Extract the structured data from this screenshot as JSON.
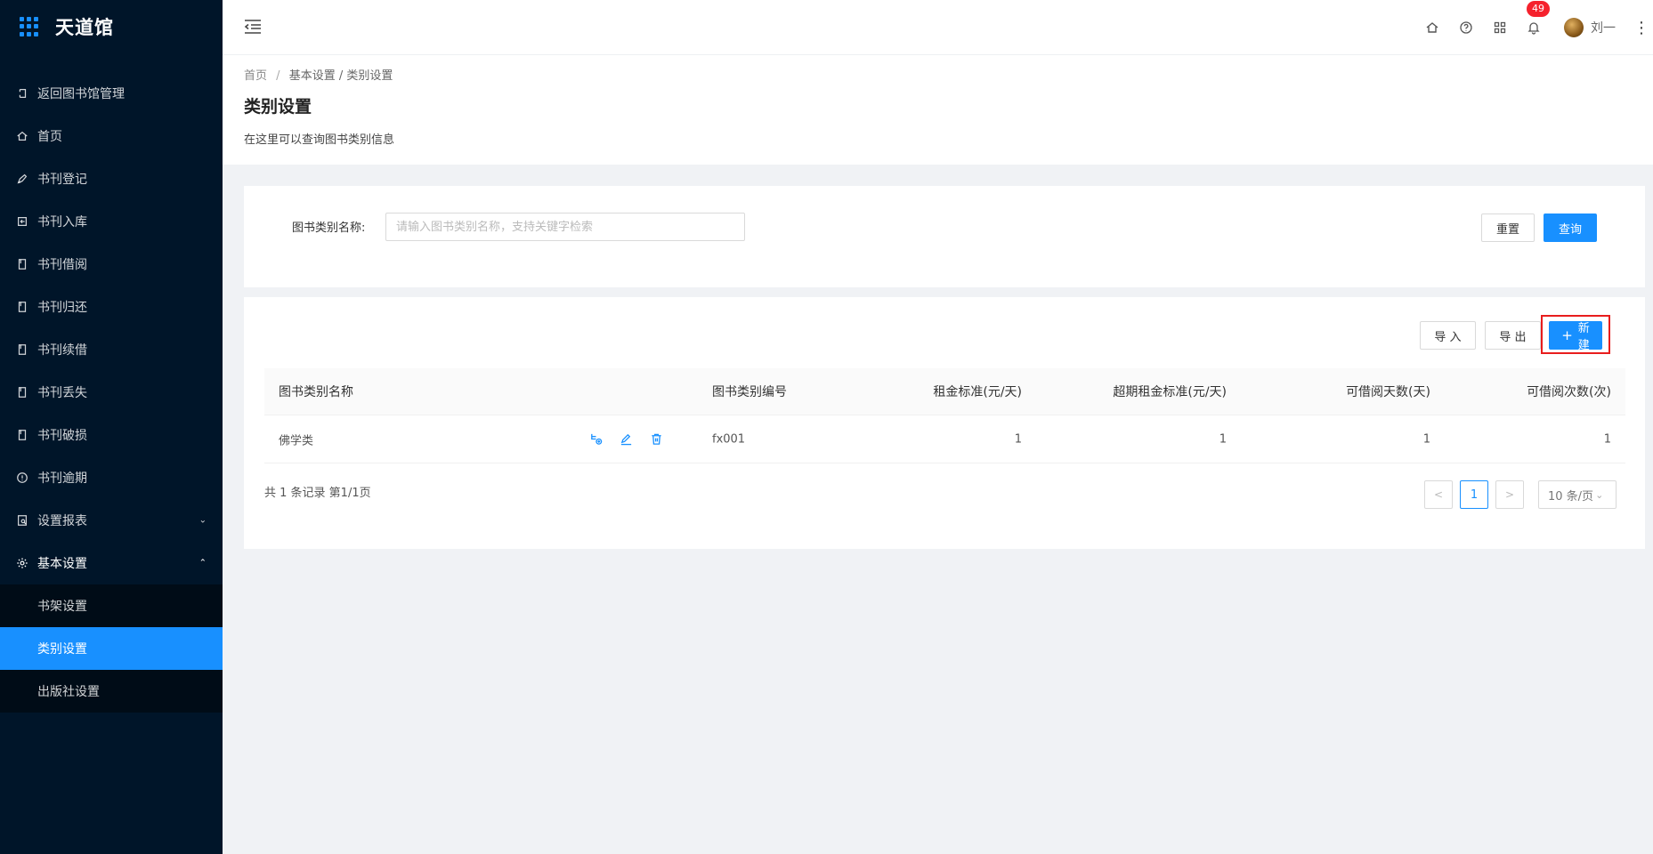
{
  "app": {
    "title": "天道馆"
  },
  "sidebar": {
    "items": [
      {
        "label": "返回图书馆管理",
        "icon": "return-icon"
      },
      {
        "label": "首页",
        "icon": "home-icon"
      },
      {
        "label": "书刊登记",
        "icon": "pen-icon"
      },
      {
        "label": "书刊入库",
        "icon": "import-icon"
      },
      {
        "label": "书刊借阅",
        "icon": "book-icon"
      },
      {
        "label": "书刊归还",
        "icon": "book-icon"
      },
      {
        "label": "书刊续借",
        "icon": "book-icon"
      },
      {
        "label": "书刊丢失",
        "icon": "book-icon"
      },
      {
        "label": "书刊破损",
        "icon": "book-icon"
      },
      {
        "label": "书刊逾期",
        "icon": "alert-icon"
      },
      {
        "label": "设置报表",
        "icon": "report-icon"
      },
      {
        "label": "基本设置",
        "icon": "gear-icon"
      }
    ],
    "submenu": [
      {
        "label": "书架设置"
      },
      {
        "label": "类别设置",
        "active": true
      },
      {
        "label": "出版社设置"
      }
    ]
  },
  "header": {
    "notification_count": "49",
    "username": "刘一"
  },
  "breadcrumb": {
    "home": "首页",
    "separator": "/",
    "middle": "基本设置 / 类别设置"
  },
  "page": {
    "title": "类别设置",
    "description": "在这里可以查询图书类别信息"
  },
  "search": {
    "label": "图书类别名称:",
    "placeholder": "请输入图书类别名称，支持关键字检索",
    "value": "",
    "reset_label": "重置",
    "query_label": "查询"
  },
  "toolbar": {
    "import_label": "导 入",
    "export_label": "导 出",
    "new_plus": "+",
    "new_label": "新建"
  },
  "table": {
    "columns": {
      "name": "图书类别名称",
      "code": "图书类别编号",
      "rent": "租金标准(元/天)",
      "overdue_rent": "超期租金标准(元/天)",
      "days": "可借阅天数(天)",
      "times": "可借阅次数(次)"
    },
    "rows": [
      {
        "name": "佛学类",
        "code": "fx001",
        "rent": "1",
        "overdue_rent": "1",
        "days": "1",
        "times": "1"
      }
    ]
  },
  "pagination": {
    "total_text": "共 1 条记录 第1/1页",
    "prev": "<",
    "current_page": "1",
    "next": ">",
    "page_size": "10 条/页"
  },
  "colors": {
    "primary": "#1890ff",
    "sidebar_bg": "#001529",
    "highlight_border": "#e81d1d",
    "badge": "#f5222d"
  }
}
